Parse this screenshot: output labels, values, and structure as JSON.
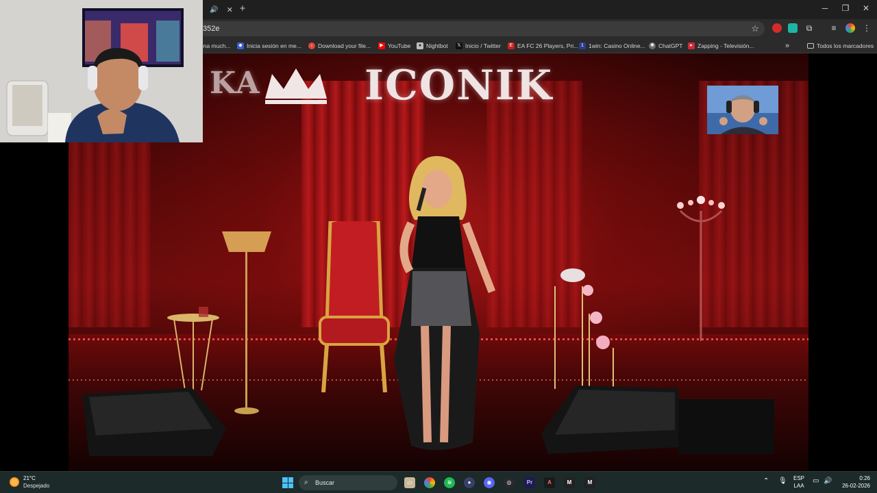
{
  "browser": {
    "tab": {
      "audio_icon": "speaker-icon",
      "close_label": "✕"
    },
    "new_tab_label": "+",
    "window_controls": {
      "minimize": "─",
      "restore": "❐",
      "close": "✕"
    },
    "address": {
      "url_text": "352e",
      "bookmark_star": "☆"
    },
    "bookmarks": [
      {
        "label": "ona much...",
        "icon": "none",
        "color": "#2b2b2b"
      },
      {
        "label": "Inicia sesión en me...",
        "icon": "doc-icon",
        "color": "#3a5ccc"
      },
      {
        "label": "Download your file...",
        "icon": "download-icon",
        "color": "#e0463a"
      },
      {
        "label": "YouTube",
        "icon": "youtube-icon",
        "color": "#ff0000"
      },
      {
        "label": "Nightbot",
        "icon": "robot-icon",
        "color": "#bdbdbd"
      },
      {
        "label": "Inicio / Twitter",
        "icon": "x-icon",
        "color": "#111111"
      },
      {
        "label": "EA FC 26 Players, Pri...",
        "icon": "ea-icon",
        "color": "#c6211f"
      },
      {
        "label": "1win: Casino Online...",
        "icon": "casino-icon",
        "color": "#2a3e8c"
      },
      {
        "label": "ChatGPT",
        "icon": "chatgpt-icon",
        "color": "#6e6e6e"
      },
      {
        "label": "Zapping - Televisión...",
        "icon": "tv-icon",
        "color": "#d0283a"
      }
    ],
    "bookmarks_overflow": "»",
    "all_bookmarks_label": "Todos los marcadores"
  },
  "video": {
    "logo_left": "KA",
    "logo_main": "ICONIK"
  },
  "taskbar": {
    "weather": {
      "temp": "21°C",
      "condition": "Despejado"
    },
    "search_label": "Buscar",
    "tray": {
      "language": "ESP",
      "layout": "LAA",
      "time": "0:26",
      "date": "26-02-2026"
    }
  }
}
